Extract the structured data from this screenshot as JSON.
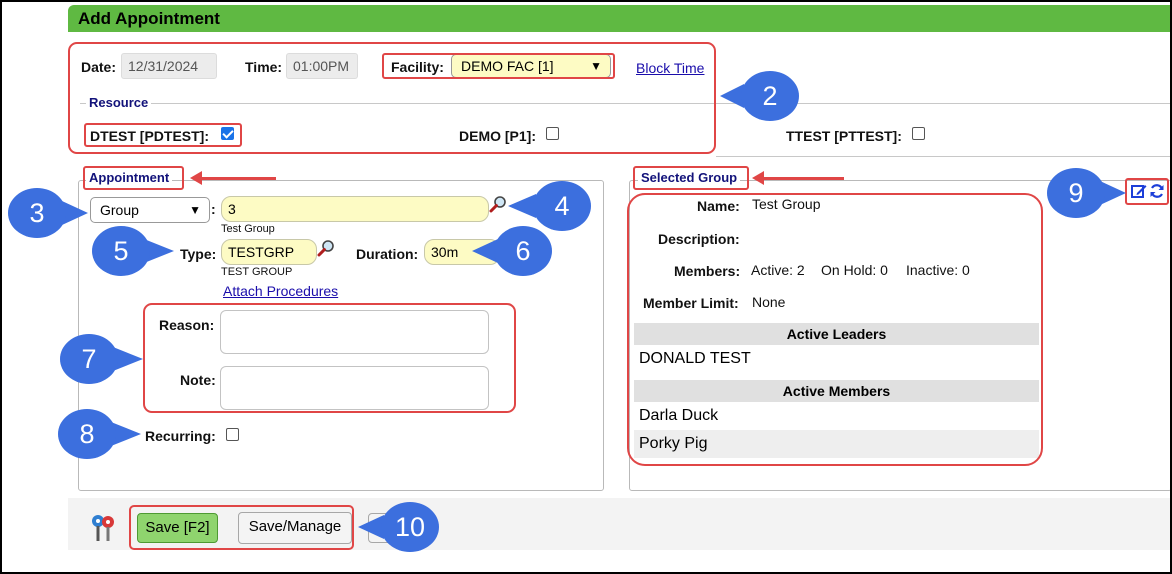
{
  "header": {
    "title": "Add Appointment"
  },
  "appointment_info": {
    "date_label": "Date:",
    "date_value": "12/31/2024",
    "time_label": "Time:",
    "time_value": "01:00PM",
    "facility_label": "Facility:",
    "facility_value": "DEMO FAC [1]",
    "block_time_link": "Block Time"
  },
  "resource": {
    "legend": "Resource",
    "items": [
      {
        "label": "DTEST [PDTEST]:",
        "checked": true
      },
      {
        "label": "DEMO [P1]:",
        "checked": false
      },
      {
        "label": "TTEST [PTTEST]:",
        "checked": false
      }
    ]
  },
  "appointment": {
    "legend": "Appointment",
    "kind_select": "Group",
    "colon": ":",
    "group_id_value": "3",
    "group_name": "Test Group",
    "type_label": "Type:",
    "type_value": "TESTGRP",
    "type_name": "TEST GROUP",
    "duration_label": "Duration:",
    "duration_value": "30m",
    "attach_procedures_link": "Attach Procedures",
    "reason_label": "Reason:",
    "note_label": "Note:",
    "recurring_label": "Recurring:"
  },
  "selected_group": {
    "legend": "Selected Group",
    "name_label": "Name:",
    "name_value": "Test Group",
    "description_label": "Description:",
    "members_label": "Members:",
    "members_active": "Active: 2",
    "members_on_hold": "On Hold: 0",
    "members_inactive": "Inactive: 0",
    "member_limit_label": "Member Limit:",
    "member_limit_value": "None",
    "active_leaders_header": "Active Leaders",
    "active_leaders": [
      "DONALD TEST"
    ],
    "active_members_header": "Active Members",
    "active_members": [
      "Darla Duck",
      "Porky Pig"
    ]
  },
  "footer": {
    "save_label": "Save [F2]",
    "save_manage_label": "Save/Manage"
  },
  "callouts": [
    "2",
    "3",
    "4",
    "5",
    "6",
    "7",
    "8",
    "9",
    "10"
  ],
  "colors": {
    "header_green": "#5fb942",
    "highlight_red": "#e04646",
    "callout_blue": "#3c6fde",
    "field_yellow": "#fdfbc4",
    "link_blue": "#1a0dab"
  }
}
